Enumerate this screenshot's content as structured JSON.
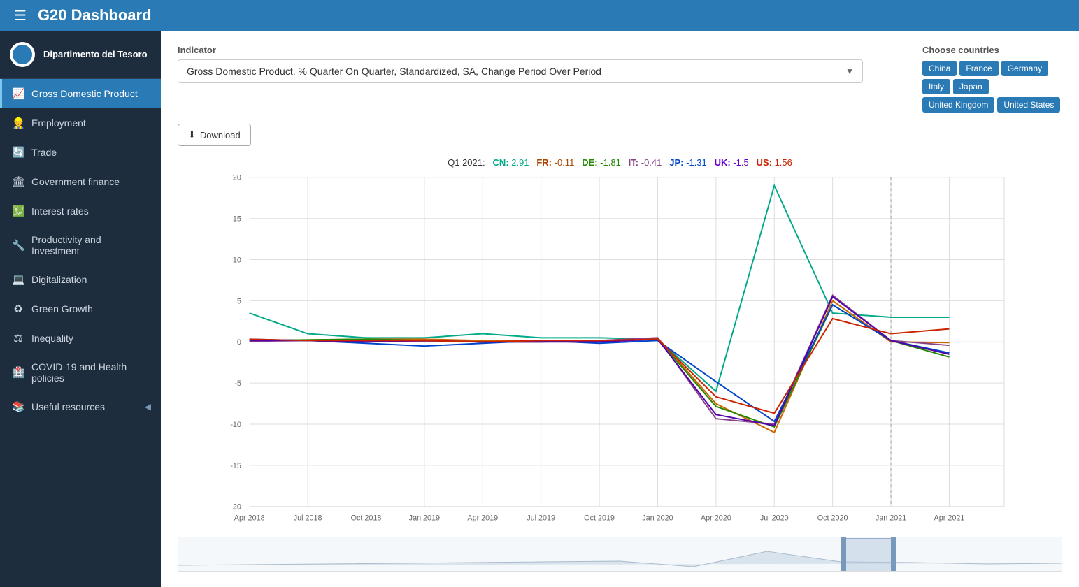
{
  "header": {
    "title": "G20 Dashboard",
    "hamburger": "☰"
  },
  "sidebar": {
    "brand_name": "Dipartimento del Tesoro",
    "items": [
      {
        "id": "gdp",
        "label": "Gross Domestic Product",
        "icon": "📈",
        "active": true
      },
      {
        "id": "employment",
        "label": "Employment",
        "icon": "👷",
        "active": false
      },
      {
        "id": "trade",
        "label": "Trade",
        "icon": "🔄",
        "active": false
      },
      {
        "id": "government-finance",
        "label": "Government finance",
        "icon": "🏛",
        "active": false
      },
      {
        "id": "interest-rates",
        "label": "Interest rates",
        "icon": "💹",
        "active": false
      },
      {
        "id": "productivity-investment",
        "label": "Productivity and Investment",
        "icon": "🔧",
        "active": false
      },
      {
        "id": "digitalization",
        "label": "Digitalization",
        "icon": "💻",
        "active": false
      },
      {
        "id": "green-growth",
        "label": "Green Growth",
        "icon": "♻",
        "active": false
      },
      {
        "id": "inequality",
        "label": "Inequality",
        "icon": "⚖",
        "active": false
      },
      {
        "id": "covid",
        "label": "COVID-19 and Health policies",
        "icon": "🏥",
        "active": false
      },
      {
        "id": "resources",
        "label": "Useful resources",
        "icon": "📚",
        "active": false
      }
    ]
  },
  "indicator": {
    "label": "Indicator",
    "selected": "Gross Domestic Product, % Quarter On Quarter, Standardized, SA, Change Period Over Period"
  },
  "countries": {
    "label": "Choose countries",
    "options": [
      "China",
      "France",
      "Germany",
      "Italy",
      "Japan",
      "United Kingdom",
      "United States"
    ],
    "selected": [
      "China",
      "France",
      "Germany",
      "Italy",
      "Japan",
      "United Kingdom",
      "United States"
    ]
  },
  "download_label": "Download",
  "chart": {
    "tooltip": "Q1 2021:  CN: 2.91  FR: -0.11  DE: -1.81  IT: -0.41  JP: -1.31  UK: -1.5  US: 1.56",
    "tooltip_cn_val": "2.91",
    "tooltip_fr_val": "-0.11",
    "tooltip_de_val": "-1.81",
    "tooltip_it_val": "-0.41",
    "tooltip_jp_val": "-1.31",
    "tooltip_uk_val": "-1.5",
    "tooltip_us_val": "1.56",
    "y_labels": [
      "20",
      "15",
      "10",
      "5",
      "0",
      "-5",
      "-10",
      "-15",
      "-20"
    ],
    "x_labels": [
      "Apr 2018",
      "Jul 2018",
      "Oct 2018",
      "Jan 2019",
      "Apr 2019",
      "Jul 2019",
      "Oct 2019",
      "Jan 2020",
      "Apr 2020",
      "Jul 2020",
      "Oct 2020",
      "Jan 2021",
      "Apr 2021"
    ],
    "colors": {
      "CN": "#00aa88",
      "FR": "#aa4400",
      "DE": "#228800",
      "IT": "#884488",
      "JP": "#0044cc",
      "UK": "#6600cc",
      "US": "#cc2200"
    }
  }
}
